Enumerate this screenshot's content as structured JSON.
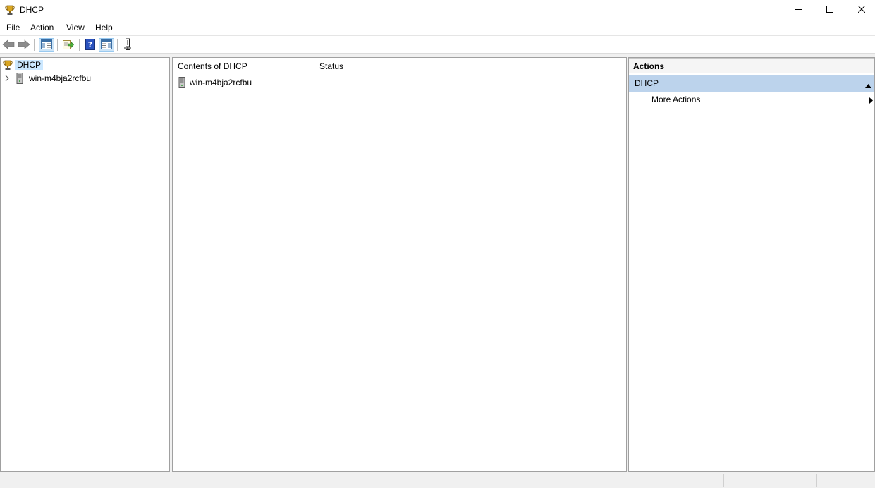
{
  "window": {
    "title": "DHCP",
    "icons": {
      "app": "dhcp-trophy-icon",
      "minimize": "minimize-icon",
      "maximize": "maximize-icon",
      "close": "close-icon"
    }
  },
  "menu": [
    "File",
    "Action",
    "View",
    "Help"
  ],
  "toolbar": {
    "buttons": [
      "back-icon",
      "forward-icon",
      "show-hide-console-tree-icon",
      "export-list-icon",
      "help-icon",
      "show-hide-action-pane-icon",
      "properties-icon"
    ]
  },
  "tree": {
    "root": {
      "label": "DHCP",
      "icon": "dhcp-trophy-icon",
      "selected": true
    },
    "children": [
      {
        "label": "win-m4bja2rcfbu",
        "icon": "server-icon",
        "expand_icon": "chevron-right-icon"
      }
    ]
  },
  "content": {
    "columns": [
      "Contents of DHCP",
      "Status"
    ],
    "rows": [
      {
        "name": "win-m4bja2rcfbu",
        "status": "",
        "icon": "server-icon"
      }
    ]
  },
  "actions": {
    "title": "Actions",
    "section": {
      "label": "DHCP",
      "collapse_icon": "triangle-up-icon"
    },
    "items": [
      {
        "label": "More Actions",
        "submenu_icon": "triangle-right-icon"
      }
    ]
  },
  "colors": {
    "selection": "#cce8ff",
    "action_section": "#bcd3ec",
    "toolbar_pressed": "#cce4f7"
  }
}
